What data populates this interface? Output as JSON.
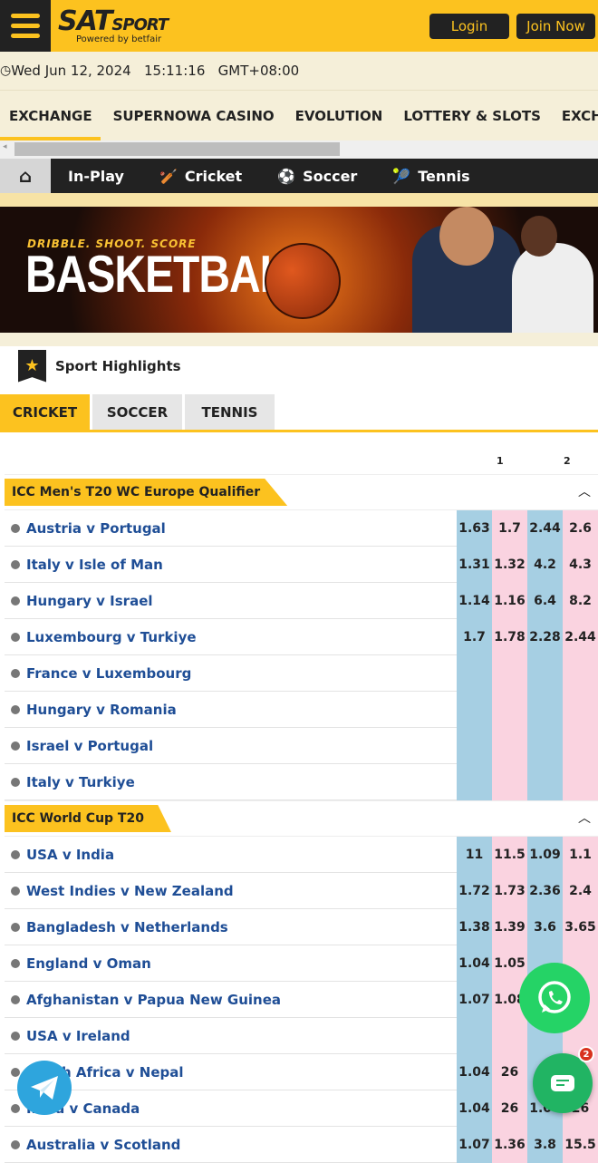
{
  "header": {
    "logo_main": "SAT",
    "logo_sub": "SPORT",
    "powered": "Powered by betfair",
    "login": "Login",
    "join": "Join Now"
  },
  "datetime": "Wed Jun 12, 2024   15:11:16   GMT+08:00",
  "nav": [
    "EXCHANGE",
    "SUPERNOWA CASINO",
    "EVOLUTION",
    "LOTTERY & SLOTS",
    "EXCHANGE"
  ],
  "sportbar": [
    {
      "label": "In-Play",
      "icon": "none"
    },
    {
      "label": "Cricket",
      "icon": "cricket-bat"
    },
    {
      "label": "Soccer",
      "icon": "soccer-ball"
    },
    {
      "label": "Tennis",
      "icon": "tennis-ball"
    }
  ],
  "banner": {
    "tagline": "DRIBBLE. SHOOT. SCORE",
    "title": "BASKETBALL"
  },
  "highlights_title": "Sport Highlights",
  "tabs": [
    "CRICKET",
    "SOCCER",
    "TENNIS"
  ],
  "col_headers": [
    "1",
    "2"
  ],
  "colors": {
    "accent": "#fcc21f",
    "back": "#a6cfe3",
    "lay": "#fad3e0",
    "dark": "#222222"
  },
  "competitions": [
    {
      "name": "ICC Men's T20 WC Europe Qualifier",
      "matches": [
        {
          "name": "Austria v Portugal",
          "odds": [
            "1.63",
            "1.7",
            "2.44",
            "2.6"
          ]
        },
        {
          "name": "Italy v Isle of Man",
          "odds": [
            "1.31",
            "1.32",
            "4.2",
            "4.3"
          ]
        },
        {
          "name": "Hungary v Israel",
          "odds": [
            "1.14",
            "1.16",
            "6.4",
            "8.2"
          ]
        },
        {
          "name": "Luxembourg v Turkiye",
          "odds": [
            "1.7",
            "1.78",
            "2.28",
            "2.44"
          ]
        },
        {
          "name": "France v Luxembourg",
          "odds": [
            "",
            "",
            "",
            ""
          ]
        },
        {
          "name": "Hungary v Romania",
          "odds": [
            "",
            "",
            "",
            ""
          ]
        },
        {
          "name": "Israel v Portugal",
          "odds": [
            "",
            "",
            "",
            ""
          ]
        },
        {
          "name": "Italy v Turkiye",
          "odds": [
            "",
            "",
            "",
            ""
          ]
        }
      ]
    },
    {
      "name": "ICC World Cup T20",
      "matches": [
        {
          "name": "USA v India",
          "odds": [
            "11",
            "11.5",
            "1.09",
            "1.1"
          ]
        },
        {
          "name": "West Indies v New Zealand",
          "odds": [
            "1.72",
            "1.73",
            "2.36",
            "2.4"
          ]
        },
        {
          "name": "Bangladesh v Netherlands",
          "odds": [
            "1.38",
            "1.39",
            "3.6",
            "3.65"
          ]
        },
        {
          "name": "England v Oman",
          "odds": [
            "1.04",
            "1.05",
            "",
            ""
          ]
        },
        {
          "name": "Afghanistan v Papua New Guinea",
          "odds": [
            "1.07",
            "1.08",
            "",
            ""
          ]
        },
        {
          "name": "USA v Ireland",
          "odds": [
            "",
            "",
            "",
            ""
          ]
        },
        {
          "name": "South Africa v Nepal",
          "odds": [
            "1.04",
            "26",
            "",
            ""
          ]
        },
        {
          "name": "India v Canada",
          "odds": [
            "1.04",
            "26",
            "1.04",
            "26"
          ]
        },
        {
          "name": "Australia v Scotland",
          "odds": [
            "1.07",
            "1.36",
            "3.8",
            "15.5"
          ]
        }
      ]
    }
  ],
  "chat_badge": "2"
}
